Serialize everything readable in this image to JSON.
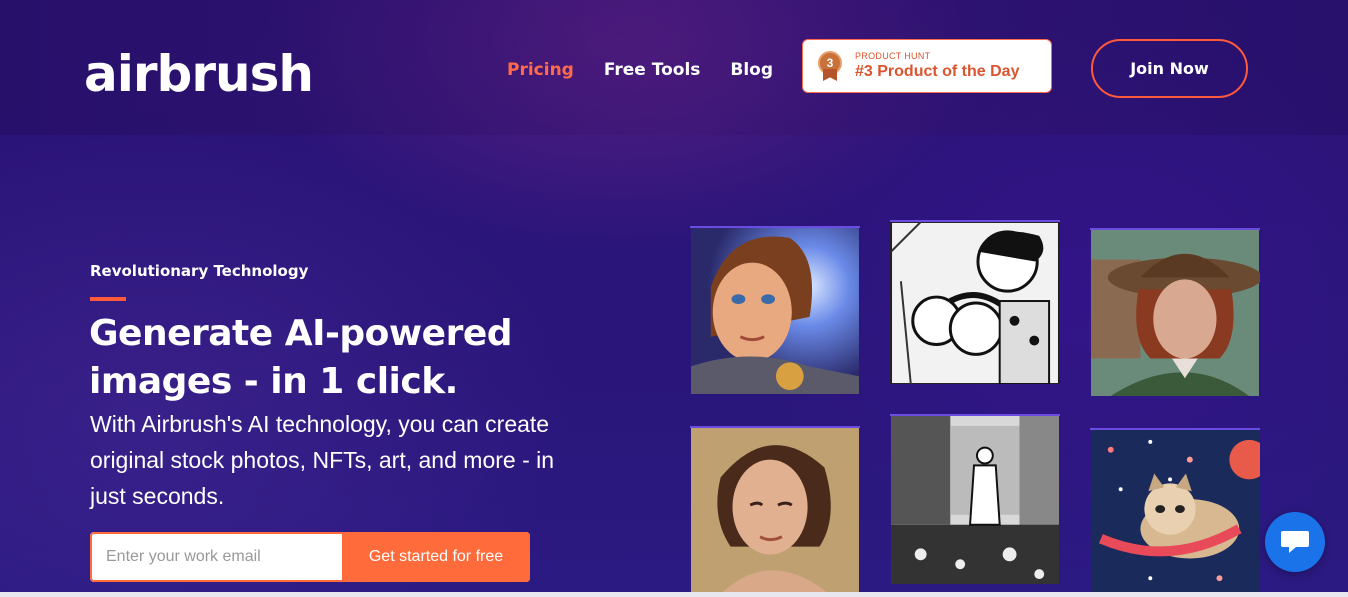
{
  "brand": {
    "logo_text": "airbrush"
  },
  "nav": {
    "items": [
      {
        "label": "Pricing",
        "active": true
      },
      {
        "label": "Free Tools",
        "active": false
      },
      {
        "label": "Blog",
        "active": false
      }
    ]
  },
  "product_hunt": {
    "label": "PRODUCT HUNT",
    "title": "#3 Product of the Day",
    "medal_number": "3"
  },
  "header": {
    "join_label": "Join Now"
  },
  "hero": {
    "eyebrow": "Revolutionary Technology",
    "headline": "Generate AI-powered images - in 1 click.",
    "subtext": "With Airbrush's AI technology, you can create original stock photos, NFTs, art, and more - in just seconds."
  },
  "signup": {
    "email_placeholder": "Enter your work email",
    "cta_label": "Get started for free"
  },
  "gallery": {
    "images": [
      {
        "name": "gallery-image-cartoon-woman"
      },
      {
        "name": "gallery-image-manga-group"
      },
      {
        "name": "gallery-image-woman-hat"
      },
      {
        "name": "gallery-image-woman-portrait"
      },
      {
        "name": "gallery-image-manga-room"
      },
      {
        "name": "gallery-image-cat-space"
      }
    ]
  },
  "colors": {
    "accent": "#ff6b3a",
    "background": "#2a1473",
    "chat": "#1a73e8"
  },
  "chat": {
    "icon": "chat-icon"
  }
}
